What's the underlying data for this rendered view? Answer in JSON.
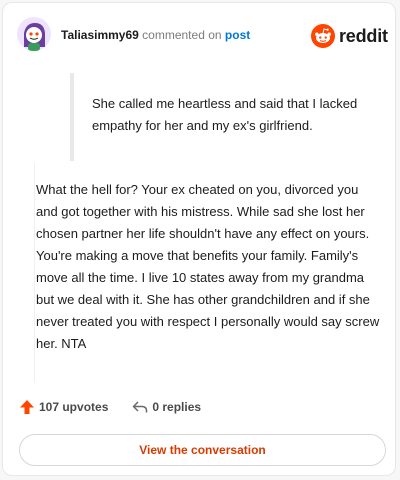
{
  "header": {
    "username": "Taliasimmy69",
    "commented_text": "commented on",
    "post_link": "post",
    "brand_word": "reddit"
  },
  "quote": {
    "text": "She called me heartless and said that I lacked empathy for her and my ex's girlfriend."
  },
  "comment": {
    "body": "What the hell for? Your ex cheated on you, divorced you and got together with his mistress. While sad she lost her chosen partner her life shouldn't have any effect on yours. You're making a move that benefits your family. Family's move all the time. I live 10 states away from my grandma but we deal with it. She has other grandchildren and if she never treated you with respect I personally would say screw her. NTA"
  },
  "actions": {
    "upvotes": "107 upvotes",
    "replies": "0 replies"
  },
  "cta": {
    "label": "View the conversation"
  },
  "colors": {
    "reddit_orange": "#ff4500",
    "cta_text": "#d93a00",
    "link_blue": "#0079d3"
  },
  "icons": {
    "avatar": "snoo-avatar",
    "brand": "reddit-logo-icon",
    "upvote": "upvote-arrow-icon",
    "reply": "reply-arrow-icon"
  }
}
